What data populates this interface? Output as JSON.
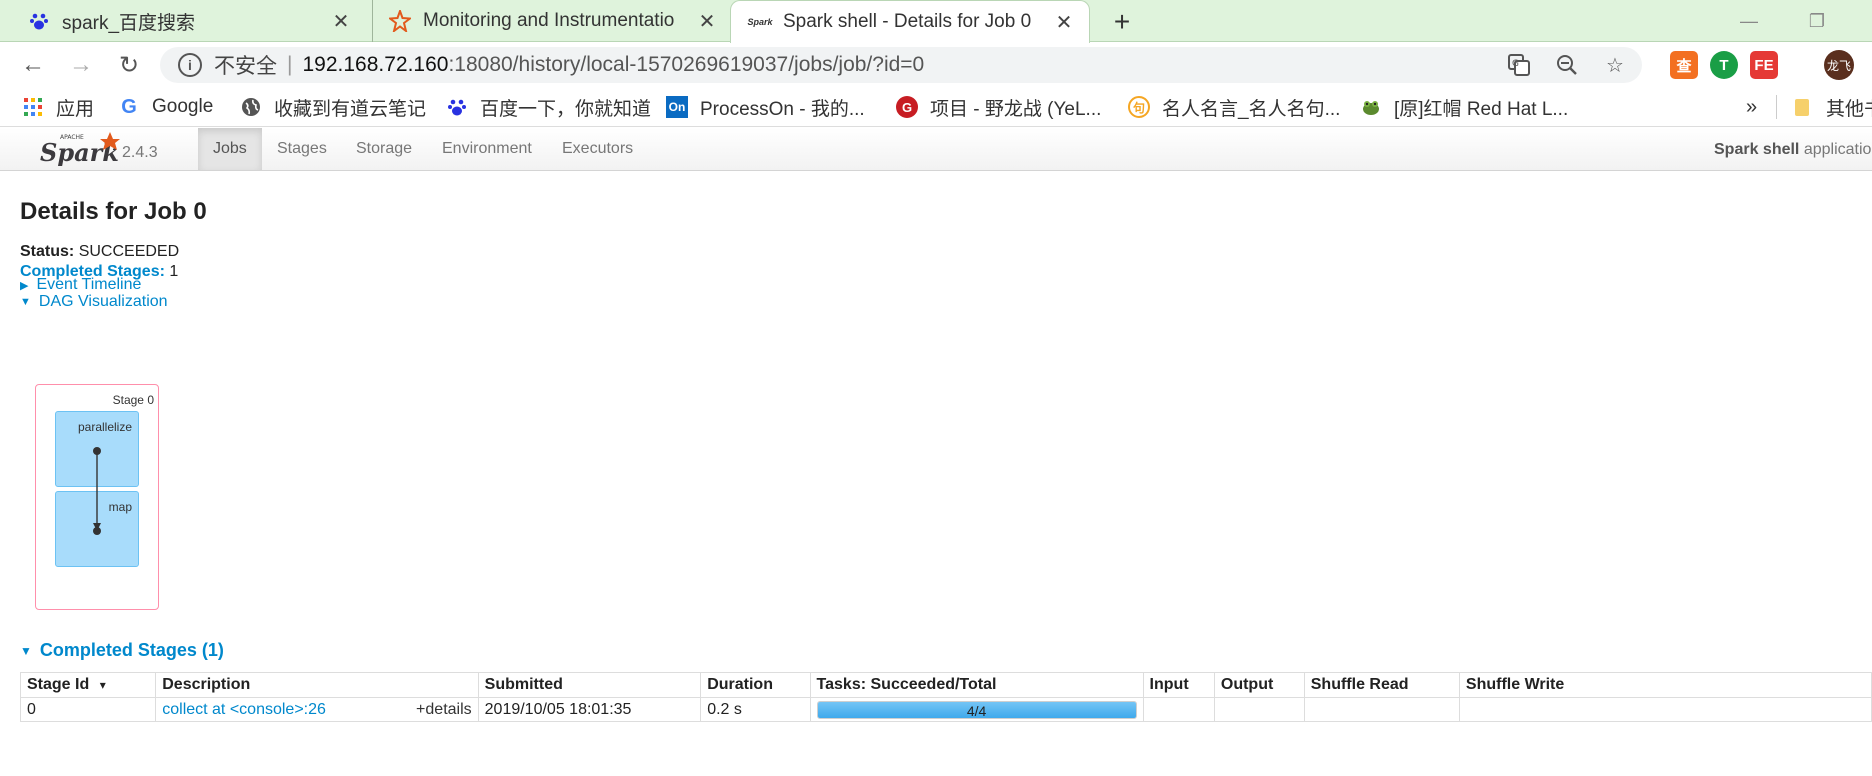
{
  "browser": {
    "tabs": [
      {
        "title": "spark_百度搜索",
        "icon": "baidu-paw-icon"
      },
      {
        "title": "Monitoring and Instrumentatio",
        "icon": "spark-star-icon"
      },
      {
        "title": "Spark shell - Details for Job 0",
        "icon": "spark-logo-icon",
        "active": true
      }
    ],
    "url": {
      "security_label": "不安全",
      "host": "192.168.72.160",
      "path": ":18080/history/local-1570269619037/jobs/job/?id=0"
    },
    "avatar_text": "龙飞",
    "bookmarks": [
      {
        "label": "应用",
        "icon": "apps-grid-icon"
      },
      {
        "label": "Google",
        "icon": "google-icon"
      },
      {
        "label": "收藏到有道云笔记",
        "icon": "globe-icon"
      },
      {
        "label": "百度一下，你就知道",
        "icon": "baidu-paw-icon"
      },
      {
        "label": "ProcessOn - 我的...",
        "icon": "processon-icon"
      },
      {
        "label": "项目 - 野龙战 (YeL...",
        "icon": "gitee-icon"
      },
      {
        "label": "名人名言_名人名句...",
        "icon": "quote-site-icon"
      },
      {
        "label": "[原]红帽 Red Hat L...",
        "icon": "frog-icon"
      }
    ],
    "bookmarks_overflow": "»",
    "other_bookmarks": "其他书"
  },
  "spark": {
    "version": "2.4.3",
    "nav": [
      "Jobs",
      "Stages",
      "Storage",
      "Environment",
      "Executors"
    ],
    "active_nav": "Jobs",
    "app_name_bold": "Spark shell",
    "app_name_rest": " application UI"
  },
  "job": {
    "title": "Details for Job 0",
    "status_label": "Status:",
    "status_value": "SUCCEEDED",
    "completed_stages_label": "Completed Stages:",
    "completed_stages_value": "1",
    "event_timeline": "Event Timeline",
    "dag_visualization": "DAG Visualization"
  },
  "dag": {
    "stage_label": "Stage 0",
    "nodes": [
      "parallelize",
      "map"
    ]
  },
  "completed_stages": {
    "heading": "Completed Stages (1)",
    "columns": [
      "Stage Id",
      "Description",
      "Submitted",
      "Duration",
      "Tasks: Succeeded/Total",
      "Input",
      "Output",
      "Shuffle Read",
      "Shuffle Write"
    ],
    "sort_indicator": "▾",
    "rows": [
      {
        "stage_id": "0",
        "description": "collect at <console>:26",
        "details": "+details",
        "submitted": "2019/10/05 18:01:35",
        "duration": "0.2 s",
        "tasks_text": "4/4",
        "tasks_succeeded": 4,
        "tasks_total": 4,
        "input": "",
        "output": "",
        "shuffle_read": "",
        "shuffle_write": ""
      }
    ]
  }
}
